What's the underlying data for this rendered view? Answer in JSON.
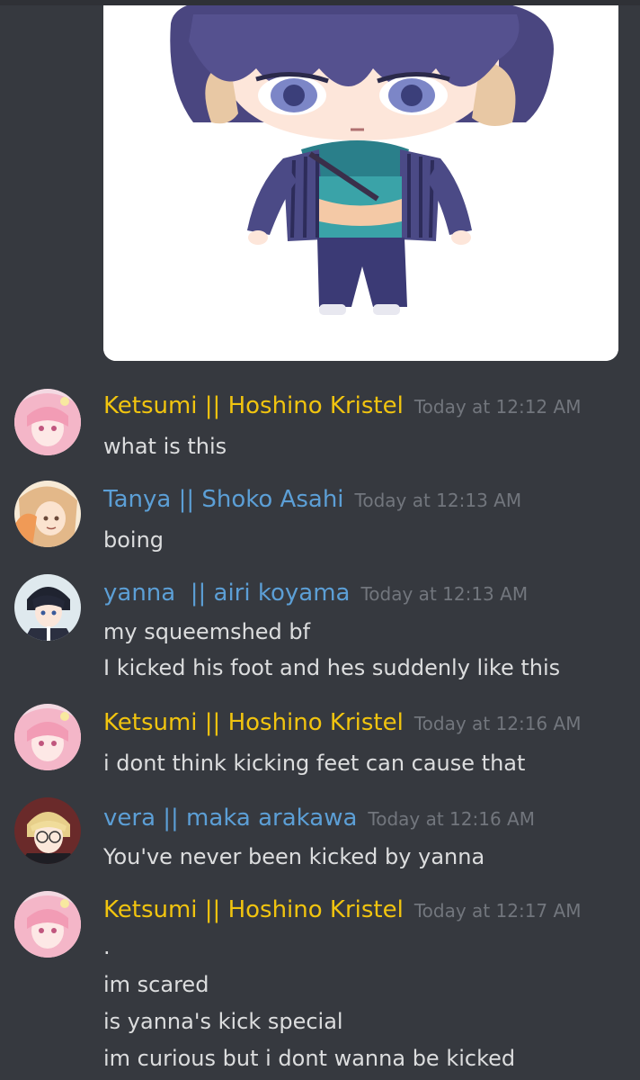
{
  "attachment": {
    "kind": "image",
    "icon": "chibi-character-image"
  },
  "colors": {
    "background": "#36393f",
    "text": "#dcddde",
    "timestamp": "#72767d",
    "role_gold": "#f1c40f",
    "role_blue": "#5c9fd6"
  },
  "messages": [
    {
      "author": "Ketsumi || Hoshino Kristel",
      "timestamp": "Today at 12:12 AM",
      "lines": [
        "what is this"
      ]
    },
    {
      "author": "Tanya || Shoko Asahi",
      "timestamp": "Today at 12:13 AM",
      "lines": [
        "boing"
      ]
    },
    {
      "author": "yanna  || airi koyama",
      "timestamp": "Today at 12:13 AM",
      "lines": [
        "my squeemshed bf",
        "I kicked his foot and hes suddenly like this"
      ]
    },
    {
      "author": "Ketsumi || Hoshino Kristel",
      "timestamp": "Today at 12:16 AM",
      "lines": [
        "i dont think kicking feet can cause that"
      ]
    },
    {
      "author": "vera || maka arakawa",
      "timestamp": "Today at 12:16 AM",
      "lines": [
        "You've never been kicked by yanna"
      ]
    },
    {
      "author": "Ketsumi || Hoshino Kristel",
      "timestamp": "Today at 12:17 AM",
      "lines": [
        ".",
        "im scared",
        "is yanna's kick special",
        "im curious but i dont wanna be kicked"
      ]
    }
  ]
}
